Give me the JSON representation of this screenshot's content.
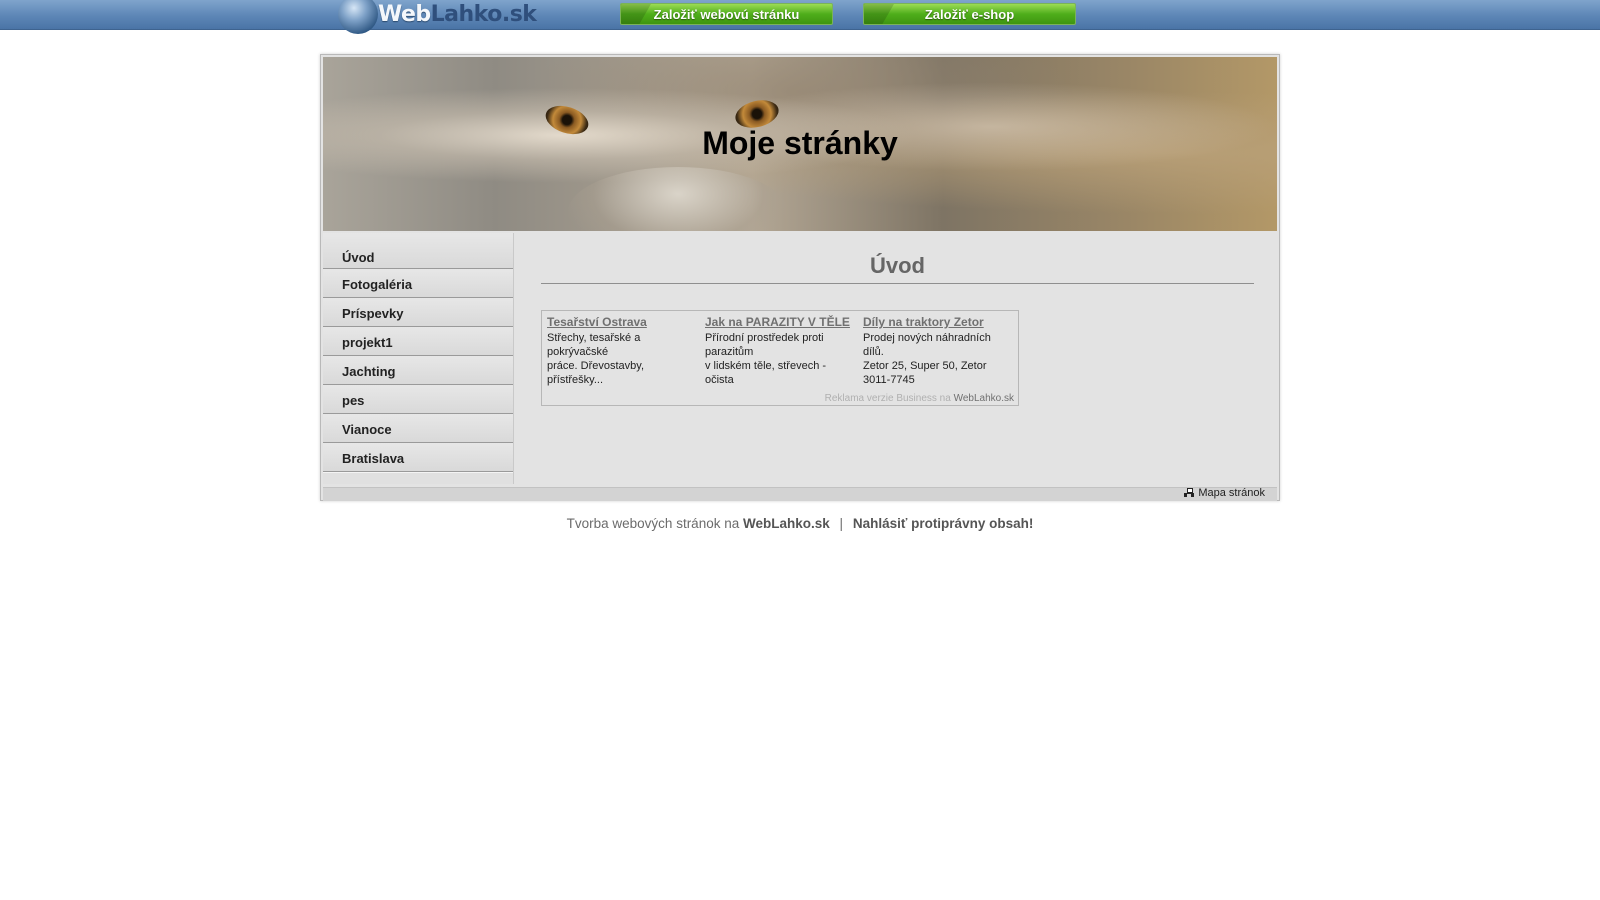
{
  "topbar": {
    "logo_web": "Web",
    "logo_rest": "Lahko.sk",
    "button_create_site": "Založiť webovú stránku",
    "button_create_eshop": "Založiť e-shop"
  },
  "site": {
    "title": "Moje stránky"
  },
  "menu": {
    "items": [
      {
        "label": "Úvod"
      },
      {
        "label": "Fotogaléria"
      },
      {
        "label": "Príspevky"
      },
      {
        "label": "projekt1"
      },
      {
        "label": "Jachting"
      },
      {
        "label": "pes"
      },
      {
        "label": "Vianoce"
      },
      {
        "label": "Bratislava"
      }
    ]
  },
  "content": {
    "heading": "Úvod"
  },
  "ads": {
    "items": [
      {
        "title": "Tesařství Ostrava",
        "text": "Střechy, tesařské a\npokrývačské\npráce. Dřevostavby,\npřístřešky..."
      },
      {
        "title": "Jak na PARAZITY V TĚLE",
        "text": "Přírodní prostředek proti\nparazitům\nv lidském těle, střevech -\nočista"
      },
      {
        "title": "Díly na traktory Zetor",
        "text": "Prodej nových náhradních\ndílů.\nZetor 25, Super 50, Zetor\n3011-7745"
      }
    ],
    "footer_text": "Reklama verzie Business na",
    "footer_link": "WebLahko.sk"
  },
  "strip": {
    "sitemap_label": "Mapa stránok"
  },
  "footer": {
    "text": "Tvorba webových stránok na",
    "link_site": "WebLahko.sk",
    "separator": "|",
    "link_report": "Nahlásiť protiprávny obsah!"
  },
  "colors": {
    "topbar": "#5d86b6",
    "button_green": "#4fae1b",
    "frame_bg": "#e3e3e3",
    "heading_gray": "#666666"
  }
}
